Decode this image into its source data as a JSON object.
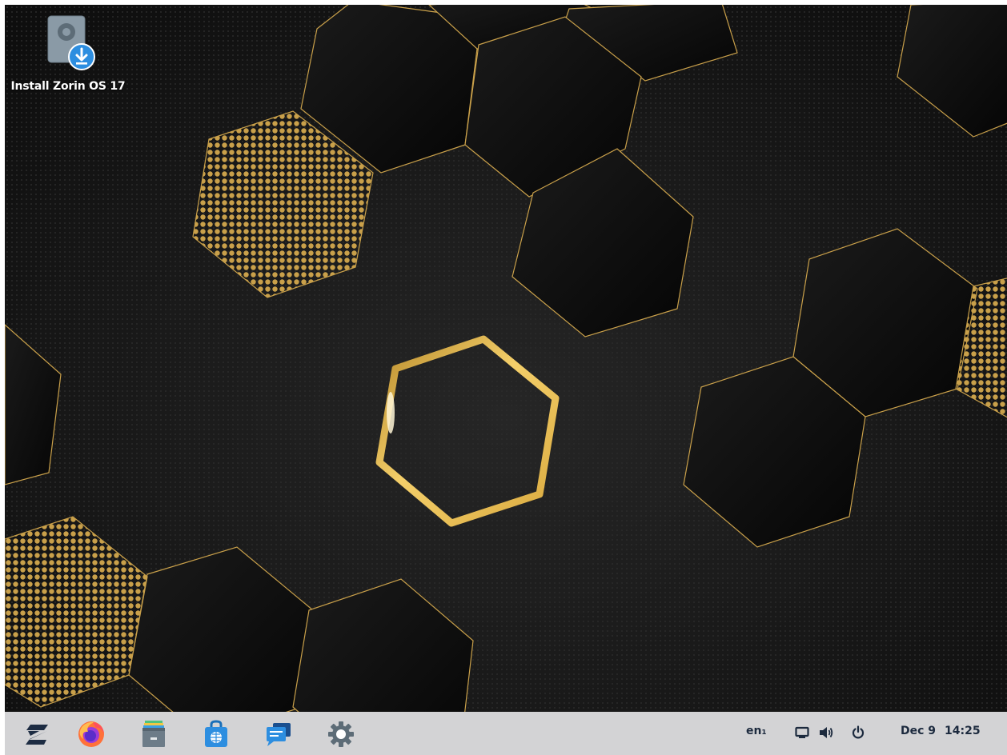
{
  "desktop": {
    "icons": [
      {
        "label": "Install Zorin OS 17",
        "icon": "drive-download-icon"
      }
    ]
  },
  "taskbar": {
    "launchers": [
      {
        "name": "zorin-menu",
        "icon": "zorin-logo-icon"
      },
      {
        "name": "firefox",
        "icon": "firefox-icon"
      },
      {
        "name": "files",
        "icon": "file-cabinet-icon"
      },
      {
        "name": "software",
        "icon": "software-store-icon"
      },
      {
        "name": "messages",
        "icon": "chat-bubbles-icon"
      },
      {
        "name": "settings",
        "icon": "gear-icon"
      }
    ],
    "tray": {
      "keyboard_layout": "en₁",
      "date": "Dec 9",
      "time": "14:25",
      "icons": [
        "display-icon",
        "volume-icon",
        "power-icon"
      ]
    }
  },
  "colors": {
    "wallpaper_base": "#141414",
    "gold": "#c9a04a",
    "taskbar": "#d3d3d5",
    "taskbar_text": "#1c2a3e",
    "accent_blue": "#2d8ee0"
  }
}
